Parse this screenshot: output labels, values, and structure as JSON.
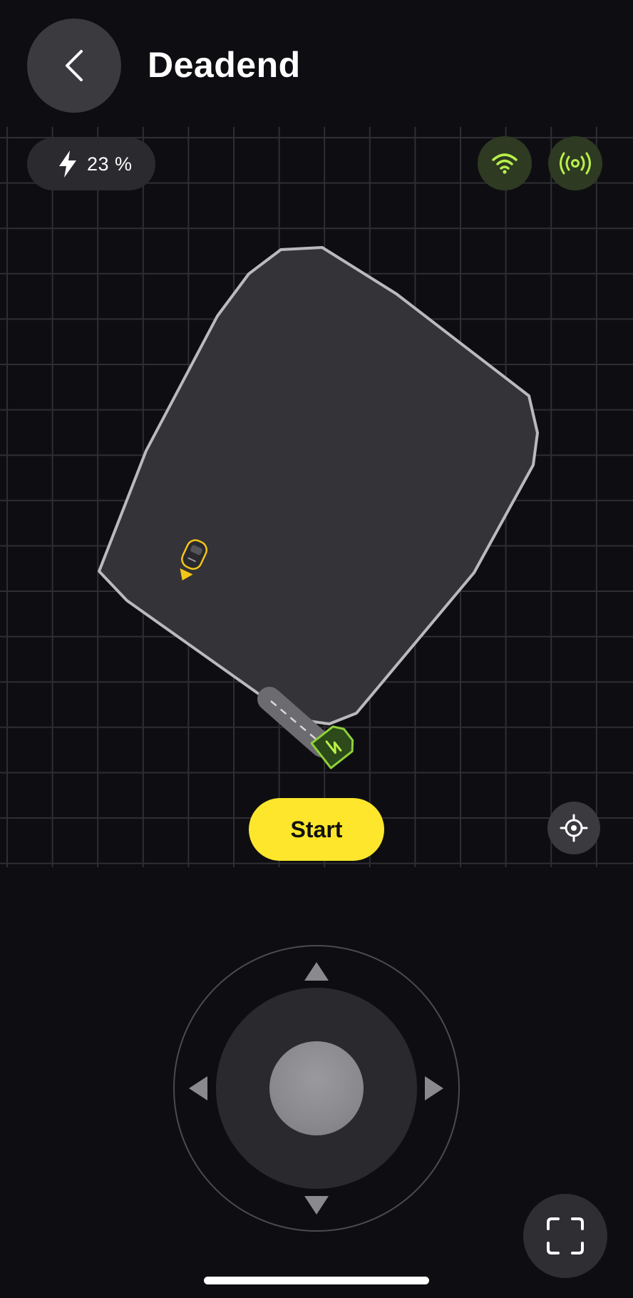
{
  "header": {
    "title": "Deadend",
    "back_icon": "chevron-left-icon"
  },
  "status": {
    "battery_icon": "lightning-icon",
    "battery_text": "23 %",
    "battery_percent": 23,
    "wifi_icon": "wifi-icon",
    "signal_icon": "broadcast-signal-icon",
    "status_accent_color": "#b8f04a"
  },
  "map": {
    "zone_fill_color": "#333338",
    "zone_border_color": "#b9b9be",
    "mower_icon": "mower-icon",
    "mower_accent_color": "#f5c518",
    "station_icon": "charging-station-icon",
    "station_color": "#8fd13a"
  },
  "actions": {
    "start_label": "Start",
    "start_color": "#fde62b",
    "locate_icon": "crosshair-icon"
  },
  "joystick": {
    "up_icon": "arrow-up-icon",
    "down_icon": "arrow-down-icon",
    "left_icon": "arrow-left-icon",
    "right_icon": "arrow-right-icon"
  },
  "footer": {
    "fullscreen_icon": "fullscreen-icon"
  }
}
